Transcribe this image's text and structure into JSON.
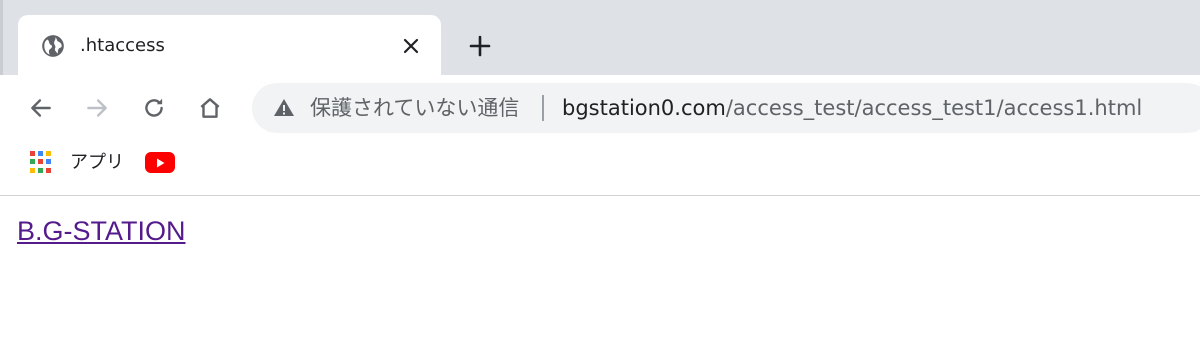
{
  "tab": {
    "title": ".htaccess",
    "favicon": "globe-icon"
  },
  "toolbar": {
    "back_icon": "back-arrow-icon",
    "forward_icon": "forward-arrow-icon",
    "reload_icon": "reload-icon",
    "home_icon": "home-icon"
  },
  "omnibox": {
    "security_icon": "warning-triangle-icon",
    "security_label": "保護されていない通信",
    "url_host": "bgstation0.com",
    "url_path": "/access_test/access_test1/access1.html"
  },
  "bookmarks": {
    "apps_label": "アプリ",
    "apps_icon": "apps-grid-icon",
    "youtube_icon": "youtube-icon"
  },
  "page": {
    "link_text": "B.G-STATION",
    "link_color": "#551a8b"
  },
  "colors": {
    "tabstrip_bg": "#dee1e6",
    "omnibox_bg": "#f1f3f4",
    "youtube_red": "#ff0000"
  }
}
